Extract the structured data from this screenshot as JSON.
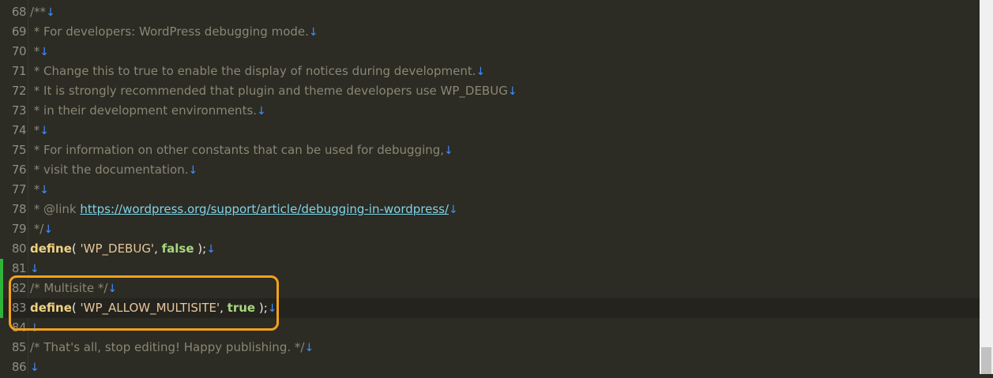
{
  "editor": {
    "eol_marker": "↓",
    "lines": [
      {
        "num": "68",
        "text": "/**"
      },
      {
        "num": "69",
        "text": " * For developers: WordPress debugging mode."
      },
      {
        "num": "70",
        "text": " *"
      },
      {
        "num": "71",
        "text": " * Change this to true to enable the display of notices during development."
      },
      {
        "num": "72",
        "text": " * It is strongly recommended that plugin and theme developers use WP_DEBUG"
      },
      {
        "num": "73",
        "text": " * in their development environments."
      },
      {
        "num": "74",
        "text": " *"
      },
      {
        "num": "75",
        "text": " * For information on other constants that can be used for debugging,"
      },
      {
        "num": "76",
        "text": " * visit the documentation."
      },
      {
        "num": "77",
        "text": " *"
      },
      {
        "num": "78",
        "prefix": " * @link ",
        "link": "https://wordpress.org/support/article/debugging-in-wordpress/"
      },
      {
        "num": "79",
        "text": " */"
      },
      {
        "num": "80",
        "kw": "define",
        "open": "( ",
        "str": "'WP_DEBUG'",
        "sep": ", ",
        "bool": "false",
        "close": " );"
      },
      {
        "num": "81",
        "text": ""
      },
      {
        "num": "82",
        "text": "/* Multisite */"
      },
      {
        "num": "83",
        "kw": "define",
        "open": "( ",
        "str": "'WP_ALLOW_MULTISITE'",
        "sep": ", ",
        "bool": "true",
        "close": " );"
      },
      {
        "num": "84",
        "text": ""
      },
      {
        "num": "85",
        "text": "/* That's all, stop editing! Happy publishing. */"
      },
      {
        "num": "86",
        "text": ""
      }
    ]
  },
  "colors": {
    "background": "#2c2b24",
    "highlight_box": "#f4a21c",
    "modified_marker": "#2fb43a",
    "eol_marker": "#3f8fff"
  }
}
